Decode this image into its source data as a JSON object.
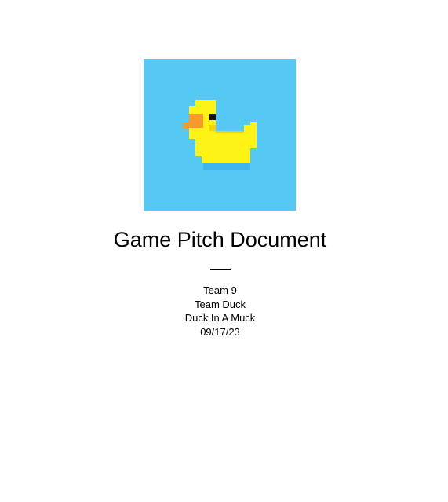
{
  "logo": {
    "icon": "pixel-rubber-duck-icon",
    "colors": {
      "background": "#55c8f4",
      "body": "#fff215",
      "body_shadow": "#f2d300",
      "beak": "#f59a2b",
      "eye": "#111111",
      "water": "#3fb6ef"
    }
  },
  "document": {
    "title": "Game Pitch Document",
    "team_number": "Team 9",
    "team_name": "Team Duck",
    "game_title": "Duck In A Muck",
    "date": "09/17/23"
  }
}
